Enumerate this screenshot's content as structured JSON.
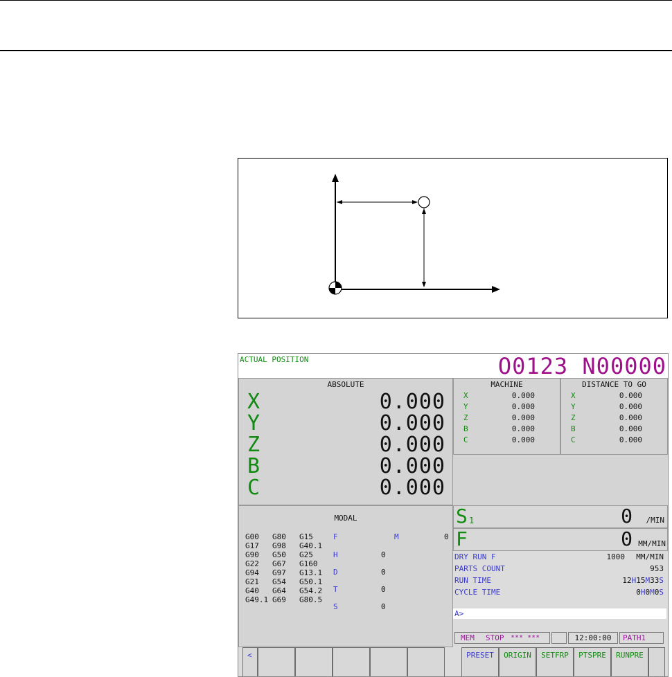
{
  "figure": {},
  "screen": {
    "title": "ACTUAL POSITION",
    "program": "O0123 N00000",
    "absolute": {
      "header": "ABSOLUTE",
      "rows": [
        {
          "axis": "X",
          "value": "0.000"
        },
        {
          "axis": "Y",
          "value": "0.000"
        },
        {
          "axis": "Z",
          "value": "0.000"
        },
        {
          "axis": "B",
          "value": "0.000"
        },
        {
          "axis": "C",
          "value": "0.000"
        }
      ]
    },
    "machine": {
      "header": "MACHINE",
      "rows": [
        {
          "axis": "X",
          "value": "0.000"
        },
        {
          "axis": "Y",
          "value": "0.000"
        },
        {
          "axis": "Z",
          "value": "0.000"
        },
        {
          "axis": "B",
          "value": "0.000"
        },
        {
          "axis": "C",
          "value": "0.000"
        }
      ]
    },
    "distance": {
      "header": "DISTANCE TO GO",
      "rows": [
        {
          "axis": "X",
          "value": "0.000"
        },
        {
          "axis": "Y",
          "value": "0.000"
        },
        {
          "axis": "Z",
          "value": "0.000"
        },
        {
          "axis": "B",
          "value": "0.000"
        },
        {
          "axis": "C",
          "value": "0.000"
        }
      ]
    },
    "modal": {
      "header": "MODAL",
      "g_codes": [
        [
          "G00",
          "G80",
          "G15"
        ],
        [
          "G17",
          "G98",
          "G40.1"
        ],
        [
          "G90",
          "G50",
          "G25"
        ],
        [
          "G22",
          "G67",
          "G160"
        ],
        [
          "G94",
          "G97",
          "G13.1"
        ],
        [
          "G21",
          "G54",
          "G50.1"
        ],
        [
          "G40",
          "G64",
          "G54.2"
        ],
        [
          "G49.1",
          "G69",
          "G80.5"
        ]
      ],
      "f_label": "F",
      "m_label": "M",
      "m_value": "0",
      "h_label": "H",
      "h_value": "0",
      "d_label": "D",
      "d_value": "0",
      "t_label": "T",
      "t_value": "0",
      "s_label": "S",
      "s_value": "0"
    },
    "spindle": {
      "label": "S",
      "sub": "1",
      "value": "0",
      "unit": "/MIN"
    },
    "feed": {
      "label": "F",
      "value": "0",
      "unit": "MM/MIN"
    },
    "info": {
      "dry_run_label": "DRY RUN F",
      "dry_run_value": "1000",
      "dry_run_unit": "MM/MIN",
      "parts_label": "PARTS COUNT",
      "parts_value": "953",
      "run_label": "RUN TIME",
      "run_h": "12",
      "run_m": "15",
      "run_s": "33",
      "cycle_label": "CYCLE TIME",
      "cycle_h": "0",
      "cycle_m": "0",
      "cycle_s": "0",
      "h_unit": "H",
      "m_unit": "M",
      "s_unit": "S"
    },
    "input_prompt": "A>",
    "status": {
      "mode": "MEM",
      "state": "STOP",
      "alarms": "*** ***",
      "time": "12:00:00",
      "path": "PATH1"
    },
    "softkeys": {
      "back": "<",
      "preset": "PRESET",
      "origin": "ORIGIN",
      "setfrp": "SETFRP",
      "ptspre": "PTSPRE",
      "runpre": "RUNPRE"
    }
  }
}
